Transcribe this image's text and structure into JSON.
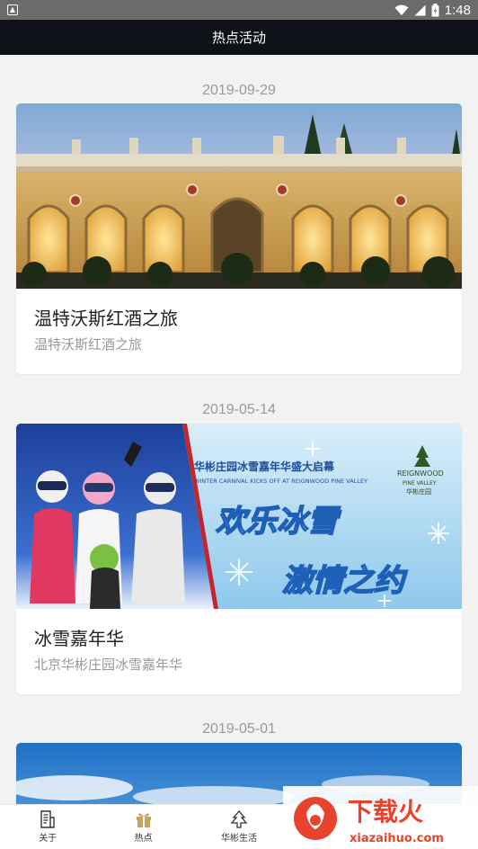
{
  "status_bar": {
    "time": "1:48",
    "notification_icon": "android-notification-icon",
    "signal_icons": [
      "wifi-icon",
      "cell-signal-icon",
      "battery-icon"
    ]
  },
  "header": {
    "title": "热点活动"
  },
  "feed": [
    {
      "date": "2019-09-29",
      "title": "温特沃斯红酒之旅",
      "subtitle": "温特沃斯红酒之旅",
      "image": "palace-building-photo"
    },
    {
      "date": "2019-05-14",
      "title": "冰雪嘉年华",
      "subtitle": "北京华彬庄园冰雪嘉年华",
      "image": "winter-carnival-banner",
      "banner_text": {
        "headline": "华彬庄园冰雪嘉年华盛大启幕",
        "english": "WINTER CARNIVAL KICKS OFF AT REIGNWOOD PINE VALLEY",
        "slogan_1": "欢乐冰雪",
        "slogan_2": "激情之约",
        "logo_name": "REIGNWOOD",
        "logo_sub": "PINE VALLEY",
        "logo_cn": "华彬庄园"
      }
    },
    {
      "date": "2019-05-01",
      "image": "sky-photo"
    }
  ],
  "bottom_nav": [
    {
      "label": "关于",
      "icon": "document-icon"
    },
    {
      "label": "热点",
      "icon": "gift-icon"
    },
    {
      "label": "华彬生活",
      "icon": "tree-icon"
    }
  ],
  "watermark": {
    "brand": "下载火",
    "domain": "xiazaihuo.com"
  },
  "colors": {
    "title_bar": "#0e1118",
    "status_bar": "#6b6b6b",
    "background": "#f2f2f2",
    "watermark_red": "#e8432c"
  }
}
